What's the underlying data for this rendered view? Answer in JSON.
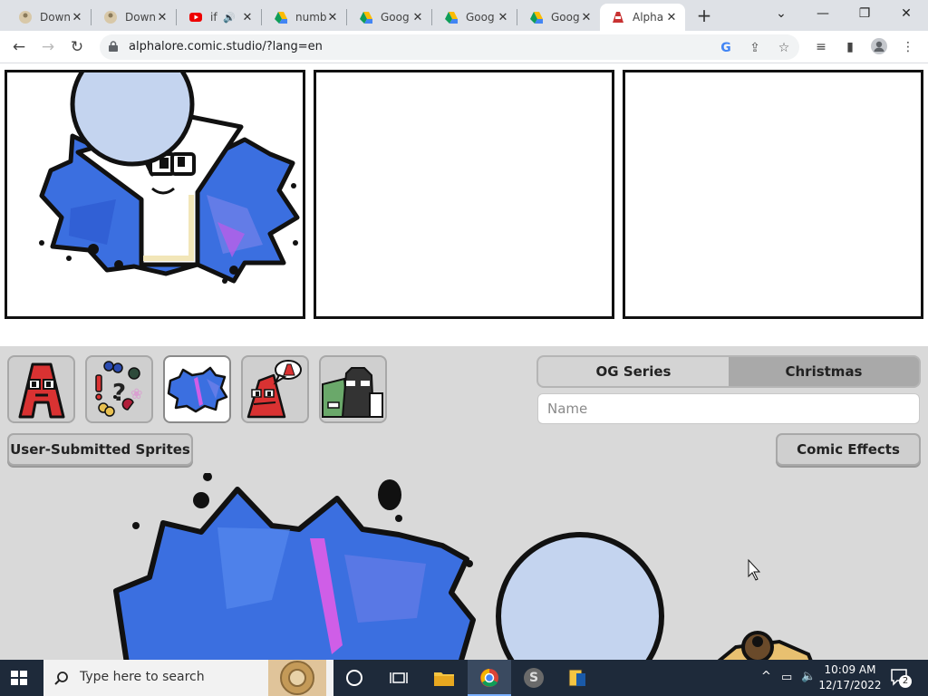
{
  "browser": {
    "tabs": [
      {
        "title": "Down",
        "favicon": "stickman-icon"
      },
      {
        "title": "Down",
        "favicon": "stickman-icon"
      },
      {
        "title": "if",
        "favicon": "youtube-icon"
      },
      {
        "title": "numb",
        "favicon": "drive-icon"
      },
      {
        "title": "Goog",
        "favicon": "drive-icon"
      },
      {
        "title": "Goog",
        "favicon": "drive-icon"
      },
      {
        "title": "Goog",
        "favicon": "drive-icon"
      },
      {
        "title": "Alpha",
        "favicon": "alphalore-icon"
      }
    ],
    "url": "alphalore.comic.studio/?lang=en"
  },
  "editor": {
    "series_options": [
      "OG Series",
      "Christmas"
    ],
    "selected_series": "OG Series",
    "name_placeholder": "Name",
    "user_sprites_label": "User-Submitted Sprites",
    "comic_effects_label": "Comic Effects",
    "sprite_categories": [
      "letter-a-sprite",
      "symbols-sprite",
      "burst-effect-sprite",
      "angry-letter-sprite",
      "dark-letters-sprite"
    ]
  },
  "taskbar": {
    "search_placeholder": "Type here to search",
    "time": "10:09 AM",
    "date": "12/17/2022",
    "notification_count": "2"
  },
  "colors": {
    "accent_blue": "#3b6fe0",
    "bubble_blue": "#c4d4ef",
    "workspace_gray": "#d9d9d9"
  }
}
